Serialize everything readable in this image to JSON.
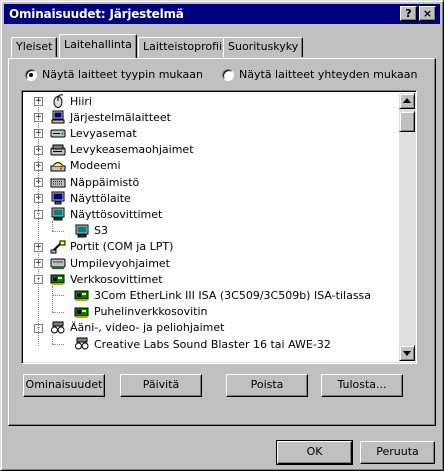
{
  "window": {
    "title": "Ominaisuudet: Järjestelmä",
    "help_glyph": "?",
    "close_glyph": "×"
  },
  "tabs": [
    {
      "label": "Yleiset",
      "active": false
    },
    {
      "label": "Laitehallinta",
      "active": true
    },
    {
      "label": "Laitteistoprofiilit",
      "active": false
    },
    {
      "label": "Suorituskyky",
      "active": false
    }
  ],
  "view_options": {
    "by_type": {
      "label": "Näytä laitteet tyypin mukaan",
      "selected": true
    },
    "by_connection": {
      "label": "Näytä laitteet yhteyden mukaan",
      "selected": false
    }
  },
  "tree": [
    {
      "label": "Hiiri",
      "icon": "mouse-icon",
      "level": 0,
      "expander": "+"
    },
    {
      "label": "Järjestelmälaitteet",
      "icon": "computer-icon",
      "level": 0,
      "expander": "+"
    },
    {
      "label": "Levyasemat",
      "icon": "disk-drive-icon",
      "level": 0,
      "expander": "+"
    },
    {
      "label": "Levykeasemaohjaimet",
      "icon": "floppy-controller-icon",
      "level": 0,
      "expander": "+"
    },
    {
      "label": "Modeemi",
      "icon": "modem-icon",
      "level": 0,
      "expander": "+"
    },
    {
      "label": "Näppäimistö",
      "icon": "keyboard-icon",
      "level": 0,
      "expander": "+"
    },
    {
      "label": "Näyttölaite",
      "icon": "monitor-icon",
      "level": 0,
      "expander": "+"
    },
    {
      "label": "Näyttösovittimet",
      "icon": "display-adapter-icon",
      "level": 0,
      "expander": "-"
    },
    {
      "label": "S3",
      "icon": "display-adapter-icon",
      "level": 1,
      "expander": ""
    },
    {
      "label": "Portit (COM ja LPT)",
      "icon": "port-icon",
      "level": 0,
      "expander": "+"
    },
    {
      "label": "Umpilevyohjaimet",
      "icon": "hard-disk-controller-icon",
      "level": 0,
      "expander": "+"
    },
    {
      "label": "Verkkosovittimet",
      "icon": "network-card-icon",
      "level": 0,
      "expander": "-"
    },
    {
      "label": "3Com EtherLink III ISA (3C509/3C509b) ISA-tilassa",
      "icon": "network-card-icon",
      "level": 1,
      "expander": ""
    },
    {
      "label": "Puhelinverkkosovitin",
      "icon": "network-card-icon",
      "level": 1,
      "expander": ""
    },
    {
      "label": "Ääni-, video- ja peliohjaimet",
      "icon": "sound-icon",
      "level": 0,
      "expander": "-"
    },
    {
      "label": "Creative Labs Sound Blaster 16 tai AWE-32",
      "icon": "sound-icon",
      "level": 1,
      "expander": ""
    }
  ],
  "actions": {
    "properties": "Ominaisuudet",
    "refresh": "Päivitä",
    "remove": "Poista",
    "print": "Tulosta..."
  },
  "footer": {
    "ok": "OK",
    "cancel": "Peruuta"
  },
  "colors": {
    "title_bar": "#000080",
    "face": "#c0c0c0"
  }
}
